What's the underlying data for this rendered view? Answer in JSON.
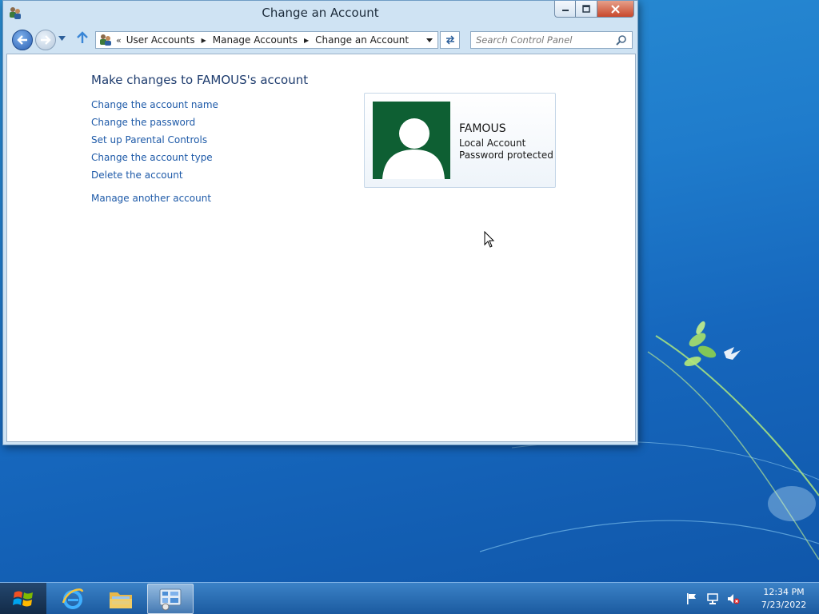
{
  "window": {
    "title": "Change an Account"
  },
  "navbar": {
    "breadcrumbs": [
      "User Accounts",
      "Manage Accounts",
      "Change an Account"
    ],
    "search_placeholder": "Search Control Panel"
  },
  "content": {
    "heading": "Make changes to FAMOUS's account",
    "links": [
      "Change the account name",
      "Change the password",
      "Set up Parental Controls",
      "Change the account type",
      "Delete the account"
    ],
    "secondary_link": "Manage another account",
    "account": {
      "name": "FAMOUS",
      "type": "Local Account",
      "status": "Password protected"
    }
  },
  "taskbar": {
    "apps": [
      "start-orb",
      "internet-explorer-icon",
      "file-explorer-icon",
      "control-panel-icon"
    ],
    "active_app": "control-panel-icon",
    "clock_time": "12:34 PM",
    "clock_date": "7/23/2022"
  },
  "colors": {
    "link": "#1e5aa8",
    "heading": "#1e3c6e",
    "avatar_bg": "#0e5f33"
  }
}
